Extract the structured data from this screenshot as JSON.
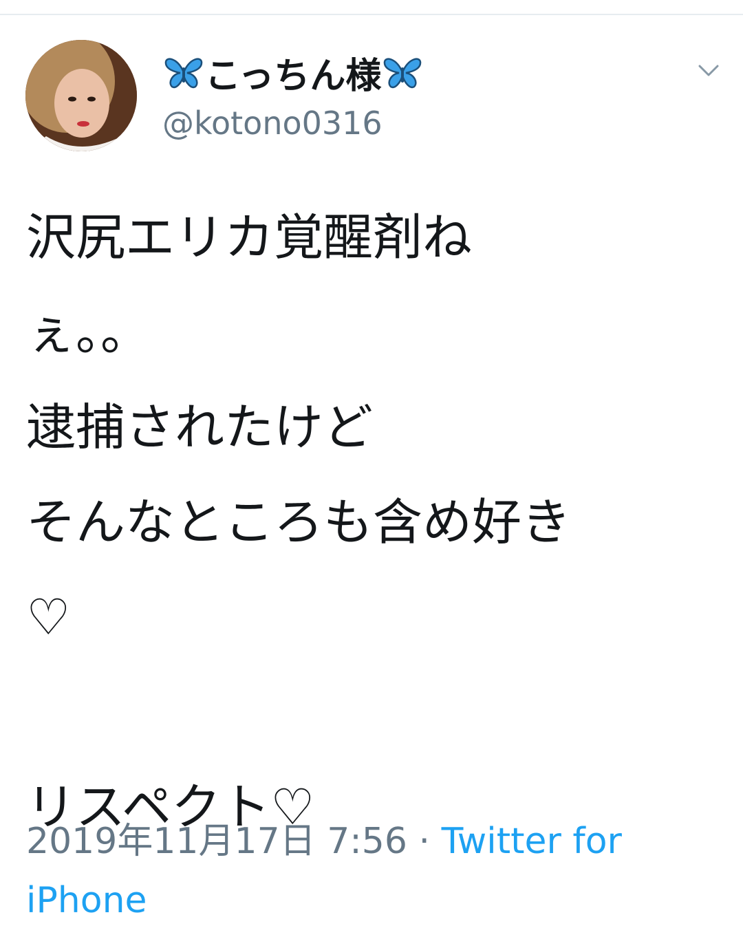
{
  "tweet": {
    "display_name": "こっちん様",
    "handle": "@kotono0316",
    "text_lines": [
      "沢尻エリカ覚醒剤ね",
      "ぇ。。",
      "逮捕されたけど",
      "そんなところも含め好き",
      "♡",
      "",
      "リスペクト♡"
    ],
    "timestamp": "2019年11月17日 7:56",
    "separator": "·",
    "source_line1": "Twitter for",
    "source_line2": "iPhone"
  },
  "icons": {
    "name_decoration": "butterfly-icon",
    "menu": "chevron-down-icon"
  },
  "colors": {
    "text": "#14171a",
    "secondary": "#657786",
    "link": "#1da1f2",
    "butterfly": "#3aa0e8"
  }
}
